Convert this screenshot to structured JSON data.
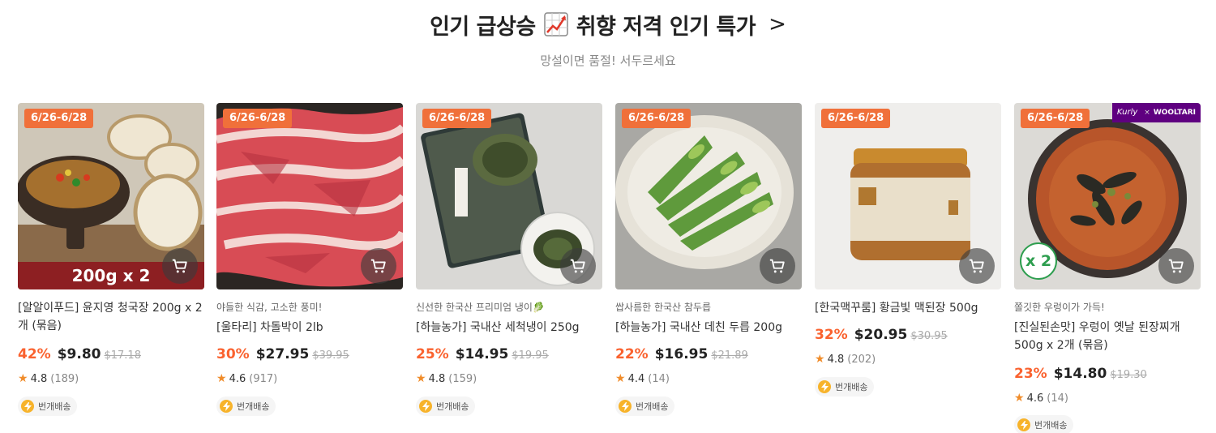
{
  "header": {
    "title": "인기 급상승",
    "title_suffix": "취향 저격 인기 특가",
    "arrow": ">",
    "subtitle": "망설이면 품절! 서두르세요"
  },
  "colors": {
    "accent": "#fa622f",
    "date_badge": "#f0703a",
    "star": "#f08c2a"
  },
  "products": [
    {
      "date": "6/26-6/28",
      "overlay_text": "200g x 2",
      "tag": "",
      "name": "[알알이푸드] 윤지영 청국장 200g x 2개 (묶음)",
      "discount": "42%",
      "price": "$9.80",
      "original_price": "$17.18",
      "rating": "4.8",
      "reviews": "(189)",
      "delivery": "번개배송"
    },
    {
      "date": "6/26-6/28",
      "tag": "야들한 식감, 고소한 풍미!",
      "name": "[울타리] 차돌박이 2lb",
      "discount": "30%",
      "price": "$27.95",
      "original_price": "$39.95",
      "rating": "4.6",
      "reviews": "(917)",
      "delivery": "번개배송"
    },
    {
      "date": "6/26-6/28",
      "tag": "신선한 한국산 프리미엄 냉이🥬",
      "name": "[하늘농가] 국내산 세척냉이 250g",
      "discount": "25%",
      "price": "$14.95",
      "original_price": "$19.95",
      "rating": "4.8",
      "reviews": "(159)",
      "delivery": "번개배송"
    },
    {
      "date": "6/26-6/28",
      "tag": "쌉사름한 한국산 참두릅",
      "name": "[하늘농가] 국내산 데친 두릅 200g",
      "discount": "22%",
      "price": "$16.95",
      "original_price": "$21.89",
      "rating": "4.4",
      "reviews": "(14)",
      "delivery": "번개배송"
    },
    {
      "date": "6/26-6/28",
      "tag": "",
      "name": "[한국맥꾸룸] 황금빛 맥된장 500g",
      "discount": "32%",
      "price": "$20.95",
      "original_price": "$30.95",
      "rating": "4.8",
      "reviews": "(202)",
      "delivery": "번개배송"
    },
    {
      "date": "6/26-6/28",
      "overlay_text": "x 2",
      "brand_left": "Kurly",
      "brand_x": "×",
      "brand_right": "WOOLTARI",
      "tag": "쫄깃한 우렁이가 가득!",
      "name": "[진실된손맛] 우렁이 옛날 된장찌개 500g x 2개 (묶음)",
      "discount": "23%",
      "price": "$14.80",
      "original_price": "$19.30",
      "rating": "4.6",
      "reviews": "(14)",
      "delivery": "번개배송"
    }
  ]
}
